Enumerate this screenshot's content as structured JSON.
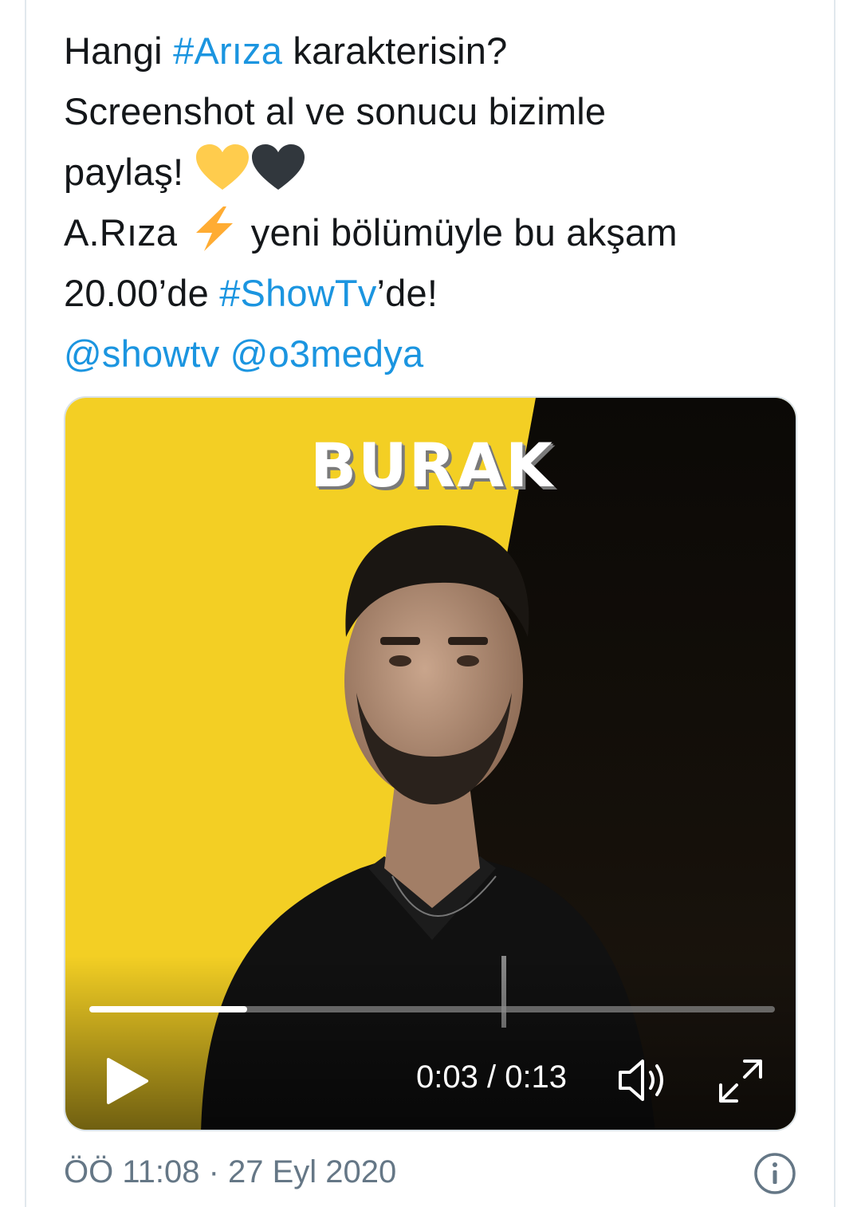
{
  "tweet": {
    "line1": {
      "pre": "Hangi ",
      "hashtag": "#Arıza",
      "post": " karakterisin?"
    },
    "line2": "Screenshot al ve sonucu bizimle",
    "line3": {
      "text": "paylaş! ",
      "emoji_icons": [
        "yellow-heart-icon",
        "black-heart-icon"
      ]
    },
    "line4": {
      "pre": "A.Rıza ",
      "emoji_icon": "high-voltage-icon",
      "post": " yeni bölümüyle bu akşam"
    },
    "line5": {
      "pre": "20.00’de ",
      "hashtag": "#ShowTv",
      "post": "’de!"
    },
    "line6": {
      "mention1": "@showtv",
      "mention2": "@o3medya"
    }
  },
  "video": {
    "overlay_title": "BURAK",
    "time_display": "0:03 / 0:13",
    "progress_fraction": 0.23,
    "controls": [
      "play-icon",
      "volume-icon",
      "fullscreen-icon"
    ]
  },
  "meta": {
    "timestamp": "ÖÖ 11:08 · 27 Eyl 2020",
    "info_icon": "info-icon"
  },
  "colors": {
    "link": "#1b95e0",
    "text": "#14171a",
    "muted": "#657786",
    "video_yellow": "#f3cf24",
    "video_dark": "#0b0906",
    "heart_yellow": "#ffcc4d",
    "heart_black": "#31373d",
    "bolt": "#ffac33"
  }
}
